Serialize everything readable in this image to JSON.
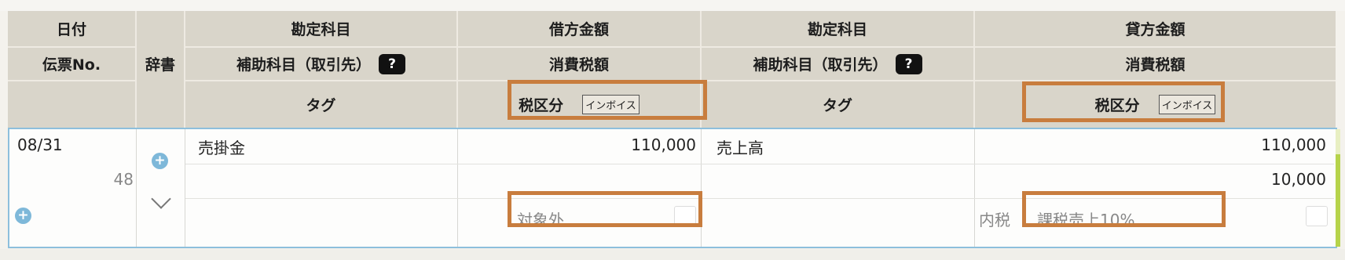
{
  "header": {
    "date": "日付",
    "slip_no": "伝票No.",
    "dictionary": "辞書",
    "debit_account": "勘定科目",
    "debit_sub": "補助科目（取引先）",
    "help": "?",
    "debit_tag": "タグ",
    "debit_amount": "借方金額",
    "debit_tax_amount": "消費税額",
    "debit_tax_class": "税区分",
    "invoice": "インボイス",
    "credit_account": "勘定科目",
    "credit_sub": "補助科目（取引先）",
    "credit_tag": "タグ",
    "credit_amount": "貸方金額",
    "credit_tax_amount": "消費税額",
    "credit_tax_class": "税区分"
  },
  "row": {
    "date": "08/31",
    "slip_no": "48",
    "debit_account": "売掛金",
    "debit_amount": "110,000",
    "debit_tax_class": "対象外",
    "credit_account": "売上高",
    "credit_amount": "110,000",
    "credit_tax_amount": "10,000",
    "credit_tax_method": "内税",
    "credit_tax_class": "課税売上10%"
  }
}
